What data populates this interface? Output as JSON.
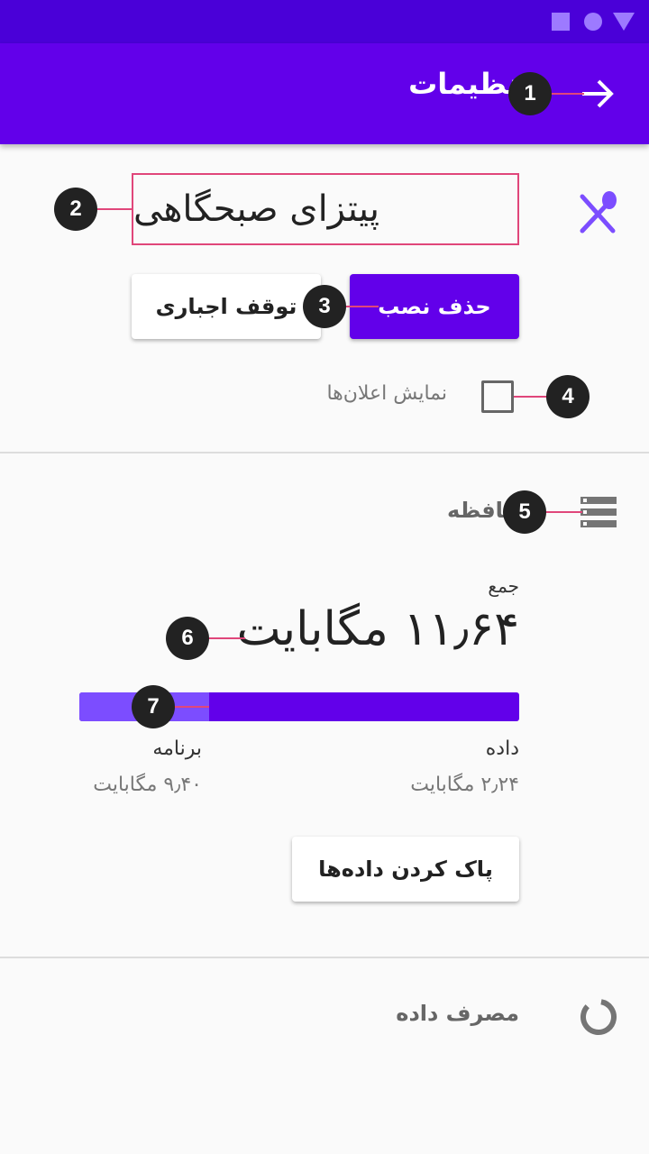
{
  "appbar": {
    "title": "تنظیمات"
  },
  "app": {
    "name": "پیتزای صبحگاهی"
  },
  "actions": {
    "uninstall": "حذف نصب",
    "force_stop": "توقف اجباری"
  },
  "notifications": {
    "label": "نمایش اعلان‌ها",
    "checked": false
  },
  "storage": {
    "title": "حافظه",
    "total_label": "جمع",
    "total_value": "۱۱٫۶۴ مگابایت",
    "data_label": "داده",
    "data_size": "۲٫۲۴ مگابایت",
    "app_label": "برنامه",
    "app_size": "۹٫۴۰ مگابایت",
    "app_fraction": 0.295,
    "clear_button": "پاک کردن داده‌ها"
  },
  "data_usage": {
    "title": "مصرف داده"
  },
  "annotations": [
    "1",
    "2",
    "3",
    "4",
    "5",
    "6",
    "7"
  ],
  "colors": {
    "primary": "#6200ea",
    "primary_dark": "#4a00d8",
    "accent_light": "#7c4dff",
    "annotation_line": "#e0467a"
  },
  "icons": {
    "back": "arrow-forward-icon",
    "app": "restaurant-icon",
    "storage": "storage-icon",
    "usage": "donut-icon"
  }
}
